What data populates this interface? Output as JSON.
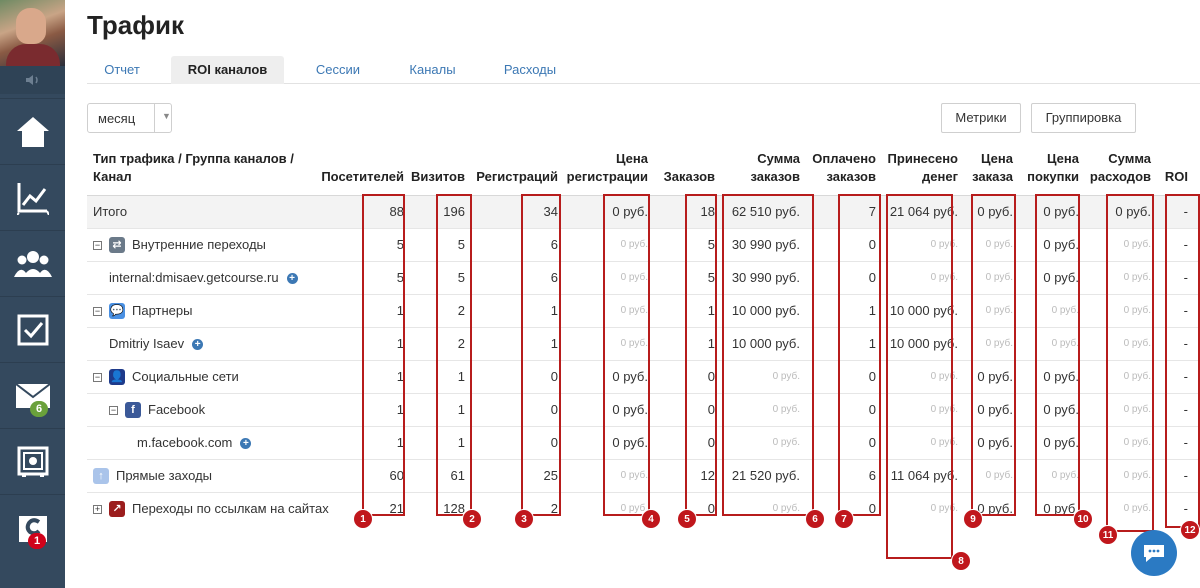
{
  "sidebar": {
    "mail_badge": "6",
    "chat_badge": "1",
    "icons": [
      "speaker-icon",
      "home-icon",
      "chart-icon",
      "users-icon",
      "tasks-icon",
      "mail-icon",
      "safe-icon",
      "getcourse-icon"
    ]
  },
  "header": {
    "title": "Трафик"
  },
  "tabs": [
    {
      "label": "Отчет"
    },
    {
      "label": "ROI каналов",
      "active": true
    },
    {
      "label": "Сессии"
    },
    {
      "label": "Каналы"
    },
    {
      "label": "Расходы"
    }
  ],
  "controls": {
    "period": "месяц",
    "metrics_button": "Метрики",
    "grouping_button": "Группировка"
  },
  "table": {
    "columns": [
      "Тип трафика / Группа каналов / Канал",
      "Посетителей",
      "Визитов",
      "Регистраций",
      "Цена регистрации",
      "Заказов",
      "Сумма заказов",
      "Оплачено заказов",
      "Принесено денег",
      "Цена заказа",
      "Цена покупки",
      "Сумма расходов",
      "ROI"
    ],
    "header_lines": [
      [
        "Тип трафика / Группа каналов /",
        "Канал"
      ],
      [
        "",
        "Посетителей"
      ],
      [
        "",
        "Визитов"
      ],
      [
        "",
        "Регистраций"
      ],
      [
        "Цена",
        "регистрации"
      ],
      [
        "",
        "Заказов"
      ],
      [
        "Сумма",
        "заказов"
      ],
      [
        "Оплачено",
        "заказов"
      ],
      [
        "Принесено",
        "денег"
      ],
      [
        "Цена",
        "заказа"
      ],
      [
        "Цена",
        "покупки"
      ],
      [
        "Сумма",
        "расходов"
      ],
      [
        "",
        "ROI"
      ]
    ],
    "rows": [
      {
        "name": "Итого",
        "level": 0,
        "icon": "",
        "toggle": "",
        "plus": false,
        "total": true,
        "cells": [
          "88",
          "196",
          "34",
          "0 руб.",
          "18",
          "62 510 руб.",
          "7",
          "21 064 руб.",
          "0 руб.",
          "0 руб.",
          "0 руб.",
          "-"
        ],
        "muted": [
          false,
          false,
          false,
          false,
          false,
          false,
          false,
          false,
          false,
          false,
          false,
          false
        ]
      },
      {
        "name": "Внутренние переходы",
        "level": 0,
        "icon": "transfer",
        "toggle": "−",
        "plus": false,
        "cells": [
          "5",
          "5",
          "6",
          "0 руб.",
          "5",
          "30 990 руб.",
          "0",
          "0 руб.",
          "0 руб.",
          "0 руб.",
          "0 руб.",
          "-"
        ],
        "muted": [
          false,
          false,
          false,
          true,
          false,
          false,
          false,
          true,
          true,
          false,
          true,
          false
        ]
      },
      {
        "name": "internal:dmisaev.getcourse.ru",
        "level": 1,
        "icon": "",
        "toggle": "",
        "plus": true,
        "cells": [
          "5",
          "5",
          "6",
          "0 руб.",
          "5",
          "30 990 руб.",
          "0",
          "0 руб.",
          "0 руб.",
          "0 руб.",
          "0 руб.",
          "-"
        ],
        "muted": [
          false,
          false,
          false,
          true,
          false,
          false,
          false,
          true,
          true,
          false,
          true,
          false
        ]
      },
      {
        "name": "Партнеры",
        "level": 0,
        "icon": "partners",
        "toggle": "−",
        "plus": false,
        "cells": [
          "1",
          "2",
          "1",
          "0 руб.",
          "1",
          "10 000 руб.",
          "1",
          "10 000 руб.",
          "0 руб.",
          "0 руб.",
          "0 руб.",
          "-"
        ],
        "muted": [
          false,
          false,
          false,
          true,
          false,
          false,
          false,
          false,
          true,
          true,
          true,
          false
        ]
      },
      {
        "name": "Dmitriy Isaev",
        "level": 1,
        "icon": "",
        "toggle": "",
        "plus": true,
        "cells": [
          "1",
          "2",
          "1",
          "0 руб.",
          "1",
          "10 000 руб.",
          "1",
          "10 000 руб.",
          "0 руб.",
          "0 руб.",
          "0 руб.",
          "-"
        ],
        "muted": [
          false,
          false,
          false,
          true,
          false,
          false,
          false,
          false,
          true,
          true,
          true,
          false
        ]
      },
      {
        "name": "Социальные сети",
        "level": 0,
        "icon": "social",
        "toggle": "−",
        "plus": false,
        "cells": [
          "1",
          "1",
          "0",
          "0 руб.",
          "0",
          "0 руб.",
          "0",
          "0 руб.",
          "0 руб.",
          "0 руб.",
          "0 руб.",
          "-"
        ],
        "muted": [
          false,
          false,
          false,
          false,
          false,
          true,
          false,
          true,
          false,
          false,
          true,
          false
        ]
      },
      {
        "name": "Facebook",
        "level": 1,
        "icon": "facebook",
        "toggle": "−",
        "plus": false,
        "cells": [
          "1",
          "1",
          "0",
          "0 руб.",
          "0",
          "0 руб.",
          "0",
          "0 руб.",
          "0 руб.",
          "0 руб.",
          "0 руб.",
          "-"
        ],
        "muted": [
          false,
          false,
          false,
          false,
          false,
          true,
          false,
          true,
          false,
          false,
          true,
          false
        ]
      },
      {
        "name": "m.facebook.com",
        "level": 2,
        "icon": "",
        "toggle": "",
        "plus": true,
        "cells": [
          "1",
          "1",
          "0",
          "0 руб.",
          "0",
          "0 руб.",
          "0",
          "0 руб.",
          "0 руб.",
          "0 руб.",
          "0 руб.",
          "-"
        ],
        "muted": [
          false,
          false,
          false,
          false,
          false,
          true,
          false,
          true,
          false,
          false,
          true,
          false
        ]
      },
      {
        "name": "Прямые заходы",
        "level": 0,
        "icon": "direct",
        "toggle": "",
        "plus": false,
        "cells": [
          "60",
          "61",
          "25",
          "0 руб.",
          "12",
          "21 520 руб.",
          "6",
          "11 064 руб.",
          "0 руб.",
          "0 руб.",
          "0 руб.",
          "-"
        ],
        "muted": [
          false,
          false,
          false,
          true,
          false,
          false,
          false,
          false,
          true,
          true,
          true,
          false
        ]
      },
      {
        "name": "Переходы по ссылкам на сайтах",
        "level": 0,
        "icon": "links",
        "toggle": "+",
        "plus": false,
        "cells": [
          "21",
          "128",
          "2",
          "0 руб.",
          "0",
          "0 руб.",
          "0",
          "0 руб.",
          "0 руб.",
          "0 руб.",
          "0 руб.",
          "-"
        ],
        "muted": [
          false,
          false,
          false,
          true,
          false,
          true,
          false,
          true,
          false,
          false,
          true,
          false
        ]
      }
    ]
  },
  "annotations": [
    "1",
    "2",
    "3",
    "4",
    "5",
    "6",
    "7",
    "8",
    "9",
    "10",
    "11",
    "12"
  ],
  "colors": {
    "sidebar": "#34495e",
    "link": "#3c78b4",
    "annotation": "#b71c1c",
    "badge_green": "#6aa13b",
    "badge_red": "#d0021b",
    "chat": "#2b7ac3"
  }
}
